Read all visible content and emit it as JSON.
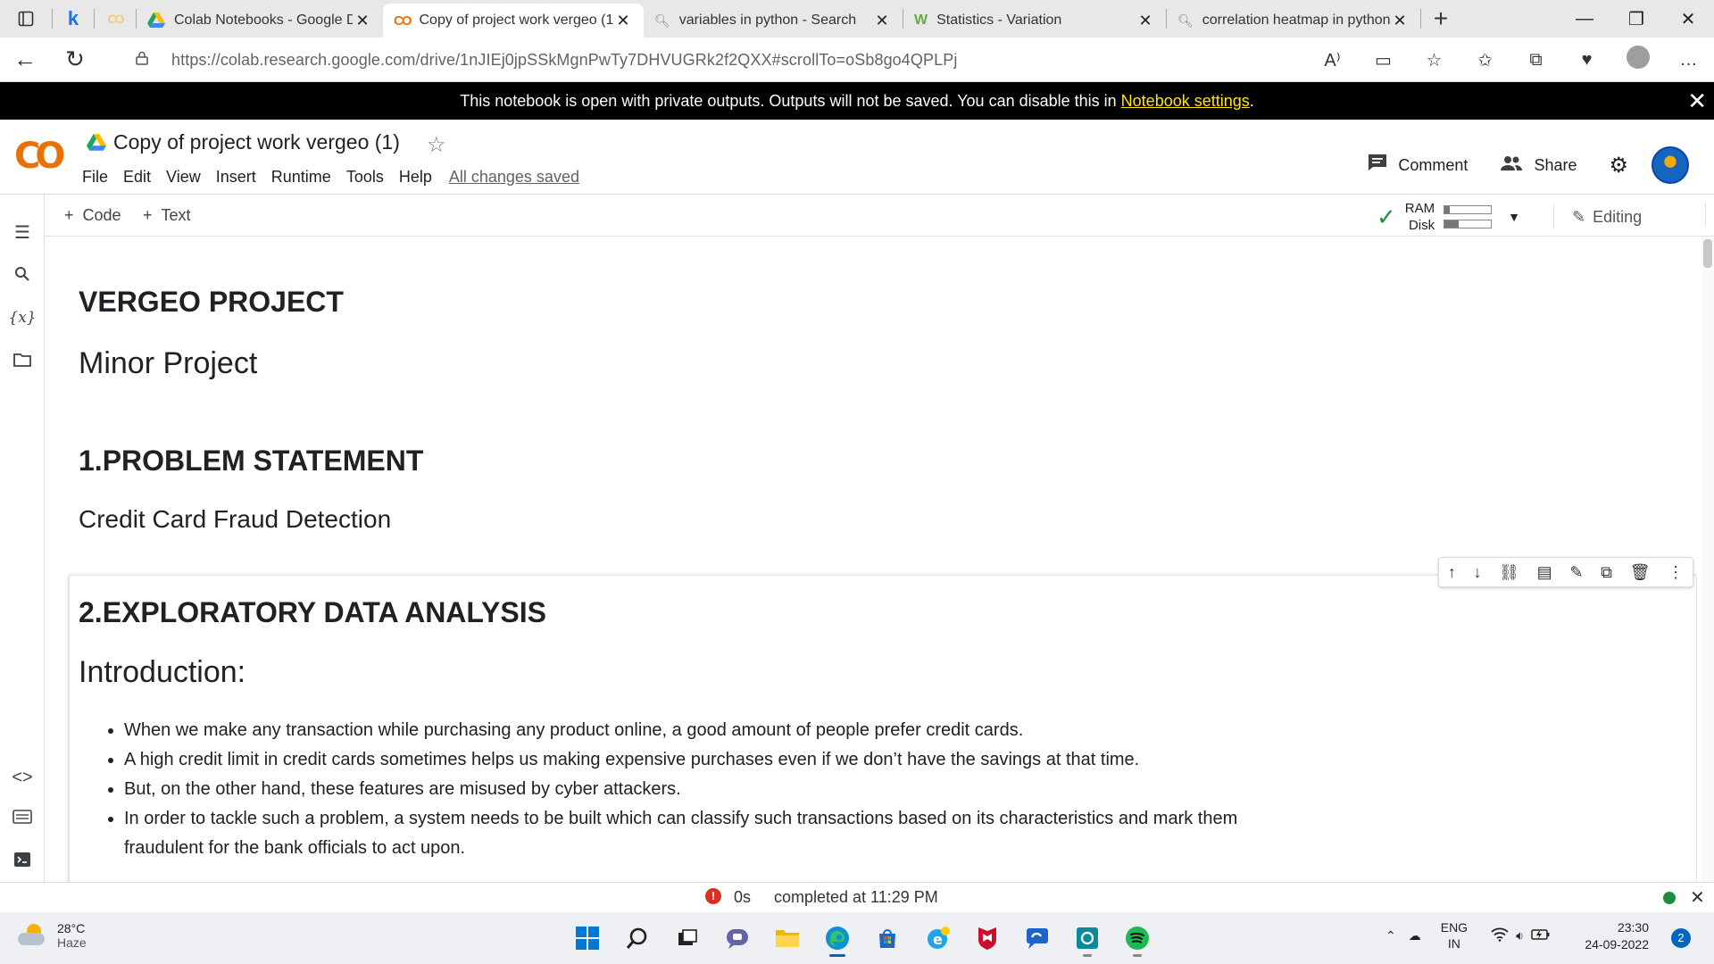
{
  "browser": {
    "tabs": [
      {
        "title": "Colab Notebooks - Google Dri",
        "icon": "google-drive-icon",
        "active": false
      },
      {
        "title": "Copy of project work vergeo (1",
        "icon": "colab-icon",
        "active": true
      },
      {
        "title": "variables in python - Search",
        "icon": "search-icon",
        "active": false
      },
      {
        "title": "Statistics - Variation",
        "icon": "wiki-icon",
        "active": false
      },
      {
        "title": "correlation heatmap in python",
        "icon": "search-icon",
        "active": false
      }
    ],
    "pinned": {
      "letter": "k",
      "colab": "CO"
    },
    "url": "https://colab.research.google.com/drive/1nJIEj0jpSSkMgnPwTy7DHVUGRk2f2QXX#scrollTo=oSb8go4QPLPj"
  },
  "banner": {
    "text": "This notebook is open with private outputs. Outputs will not be saved. You can disable this in ",
    "link": "Notebook settings",
    "suffix": "."
  },
  "colab": {
    "logo": "CO",
    "title": "Copy of project work vergeo (1)",
    "menu": [
      "File",
      "Edit",
      "View",
      "Insert",
      "Runtime",
      "Tools",
      "Help"
    ],
    "save_status": "All changes saved",
    "comment_label": "Comment",
    "share_label": "Share"
  },
  "toolbar": {
    "add_code": "Code",
    "add_text": "Text",
    "ram_label": "RAM",
    "disk_label": "Disk",
    "ram_usage": 0.12,
    "disk_usage": 0.3,
    "editing_label": "Editing"
  },
  "notebook": {
    "heading1": "VERGEO PROJECT",
    "subheading1": "Minor Project",
    "heading2": "1.PROBLEM STATEMENT",
    "para2": "Credit Card Fraud Detection",
    "heading3": "2.EXPLORATORY DATA ANALYSIS",
    "subheading3": "Introduction:",
    "bullets": [
      "When we make any transaction while purchasing any product online, a good amount of people prefer credit cards.",
      "A high credit limit in credit cards sometimes helps us making expensive purchases even if we don’t have the savings at that time.",
      "But, on the other hand, these features are misused by cyber attackers.",
      "In order to tackle such a problem, a system needs to be built which can classify such transactions based on its characteristics and mark them fraudulent for the bank officials to act upon."
    ]
  },
  "statusbar": {
    "duration": "0s",
    "message": "completed at 11:29 PM"
  },
  "taskbar": {
    "temperature": "28°C",
    "condition": "Haze",
    "lang_top": "ENG",
    "lang_bottom": "IN",
    "time": "23:30",
    "date": "24-09-2022",
    "notifications": "2"
  },
  "colors": {
    "banner_bg": "#000000",
    "banner_link": "#ffe500",
    "colab_orange": "#e8710a",
    "colab_yellow": "#f9ab00",
    "ok_green": "#1e8e3e",
    "error_red": "#d93025"
  }
}
